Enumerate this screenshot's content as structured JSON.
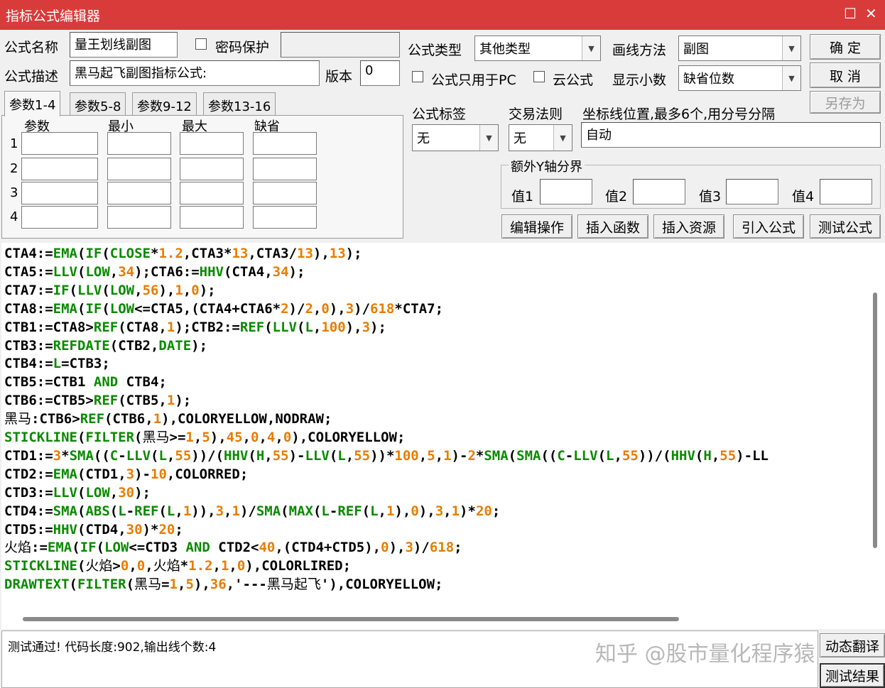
{
  "window": {
    "title": "指标公式编辑器",
    "maximize_glyph": "☐",
    "close_glyph": "✕"
  },
  "form": {
    "name_label": "公式名称",
    "name_value": "量王划线副图",
    "password_label": "密码保护",
    "desc_label": "公式描述",
    "desc_value": "黑马起飞副图指标公式:",
    "version_label": "版本",
    "version_value": "0",
    "type_label": "公式类型",
    "type_value": "其他类型",
    "draw_label": "画线方法",
    "draw_value": "副图",
    "pc_only_label": "公式只用于PC",
    "cloud_label": "云公式",
    "decimals_label": "显示小数",
    "decimals_value": "缺省位数",
    "tag_label": "公式标签",
    "tag_value": "无",
    "rule_label": "交易法则",
    "rule_value": "无",
    "coord_label": "坐标线位置,最多6个,用分号分隔",
    "coord_value": "自动",
    "yaxis_title": "额外Y轴分界",
    "y1_label": "值1",
    "y2_label": "值2",
    "y3_label": "值3",
    "y4_label": "值4"
  },
  "buttons": {
    "ok": "确  定",
    "cancel": "取  消",
    "save_as": "另存为",
    "edit_ops": "编辑操作",
    "insert_func": "插入函数",
    "insert_res": "插入资源",
    "import_formula": "引入公式",
    "test_formula": "测试公式",
    "auto_translate": "动态翻译",
    "test_result": "测试结果"
  },
  "tabs": [
    "参数1-4",
    "参数5-8",
    "参数9-12",
    "参数13-16"
  ],
  "params": {
    "headers": [
      "参数",
      "最小",
      "最大",
      "缺省"
    ],
    "rows": [
      "1",
      "2",
      "3",
      "4"
    ]
  },
  "code_lines": [
    "CTA4:=EMA(IF(CLOSE*1.2,CTA3*13,CTA3/13),13);",
    "CTA5:=LLV(LOW,34);CTA6:=HHV(CTA4,34);",
    "CTA7:=IF(LLV(LOW,56),1,0);",
    "CTA8:=EMA(IF(LOW<=CTA5,(CTA4+CTA6*2)/2,0),3)/618*CTA7;",
    "CTB1:=CTA8>REF(CTA8,1);CTB2:=REF(LLV(L,100),3);",
    "CTB3:=REFDATE(CTB2,DATE);",
    "CTB4:=L=CTB3;",
    "CTB5:=CTB1 AND CTB4;",
    "CTB6:=CTB5>REF(CTB5,1);",
    "黑马:CTB6>REF(CTB6,1),COLORYELLOW,NODRAW;",
    "STICKLINE(FILTER(黑马>=1,5),45,0,4,0),COLORYELLOW;",
    "CTD1:=3*SMA((C-LLV(L,55))/(HHV(H,55)-LLV(L,55))*100,5,1)-2*SMA(SMA((C-LLV(L,55))/(HHV(H,55)-LL",
    "CTD2:=EMA(CTD1,3)-10,COLORRED;",
    "CTD3:=LLV(LOW,30);",
    "CTD4:=SMA(ABS(L-REF(L,1)),3,1)/SMA(MAX(L-REF(L,1),0),3,1)*20;",
    "CTD5:=HHV(CTD4,30)*20;",
    "火焰:=EMA(IF(LOW<=CTD3 AND CTD2<40,(CTD4+CTD5),0),3)/618;",
    "STICKLINE(火焰>0,0,火焰*1.2,1,0),COLORLIRED;",
    "DRAWTEXT(FILTER(黑马=1,5),36,'---黑马起飞'),COLORYELLOW;"
  ],
  "status_text": "测试通过! 代码长度:902,输出线个数:4",
  "watermark": "知乎 @股市量化程序猿",
  "colors": {
    "titlebar": "#d93b3b",
    "function": "#0a8a00",
    "number": "#e87c00",
    "text": "#000000"
  }
}
